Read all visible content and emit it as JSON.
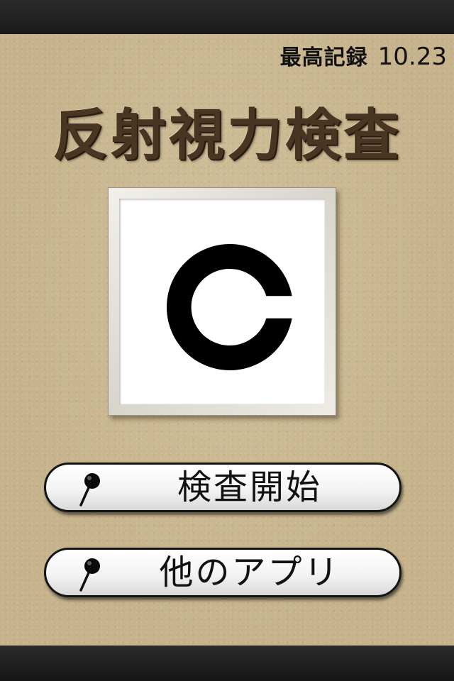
{
  "record": {
    "label": "最高記録",
    "value": "10.23"
  },
  "title": "反射視力検査",
  "chart": {
    "symbol": "landolt-c-icon"
  },
  "buttons": {
    "start": {
      "label": "検査開始",
      "icon": "pin-icon"
    },
    "other_apps": {
      "label": "他のアプリ",
      "icon": "pin-icon"
    }
  },
  "colors": {
    "background": "#c6b38c",
    "title": "#4a3422",
    "bars": "#1f1f1f",
    "button_border": "#141414"
  }
}
